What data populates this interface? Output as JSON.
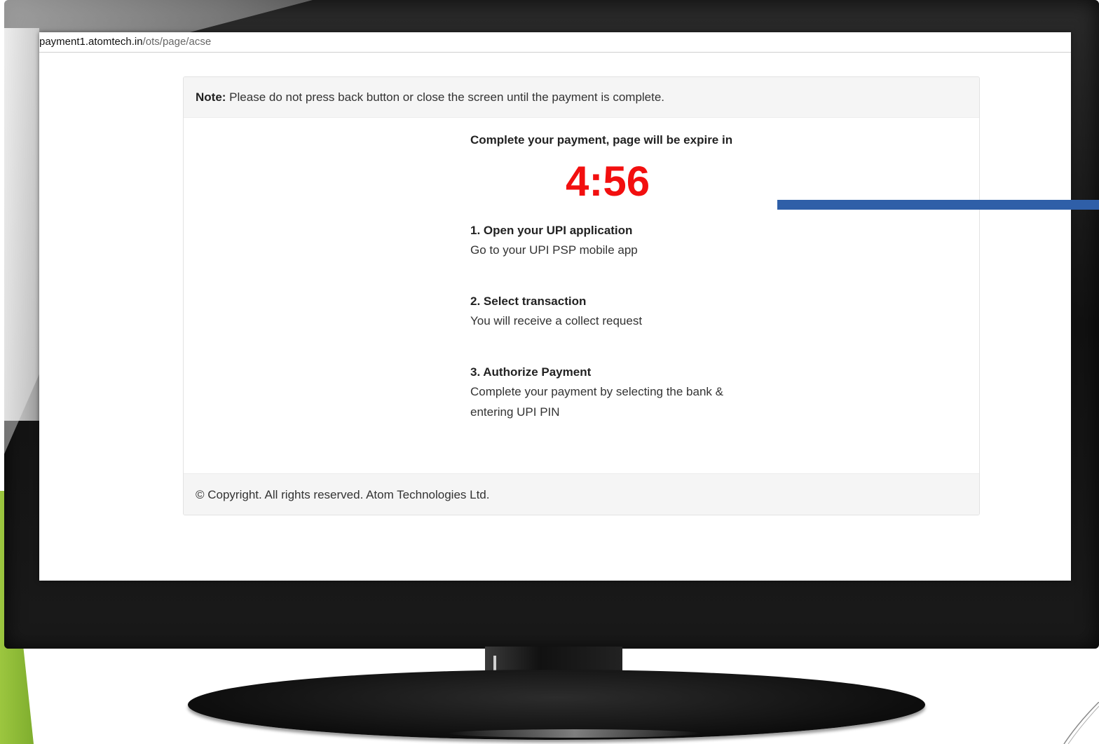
{
  "browser": {
    "url_host": "payment1.atomtech.in",
    "url_path": "/ots/page/acse"
  },
  "card": {
    "note_label": "Note:",
    "note_text": " Please do not press back button or close the screen until the payment is complete.",
    "expire_title": "Complete your payment, page will be expire in",
    "timer": "4:56",
    "steps": [
      {
        "title": "1. Open your UPI application",
        "desc": "Go to your UPI PSP mobile app"
      },
      {
        "title": "2. Select transaction",
        "desc": "You will receive a collect request"
      },
      {
        "title": "3. Authorize Payment",
        "desc": "Complete your payment by selecting the bank &",
        "desc2": "entering UPI PIN"
      }
    ],
    "footer": "© Copyright. All rights reserved. Atom Technologies Ltd."
  },
  "colors": {
    "timer": "#f20f0f",
    "annotation_line": "#2f5fa8",
    "slide_accent": "#8dbb3a"
  }
}
